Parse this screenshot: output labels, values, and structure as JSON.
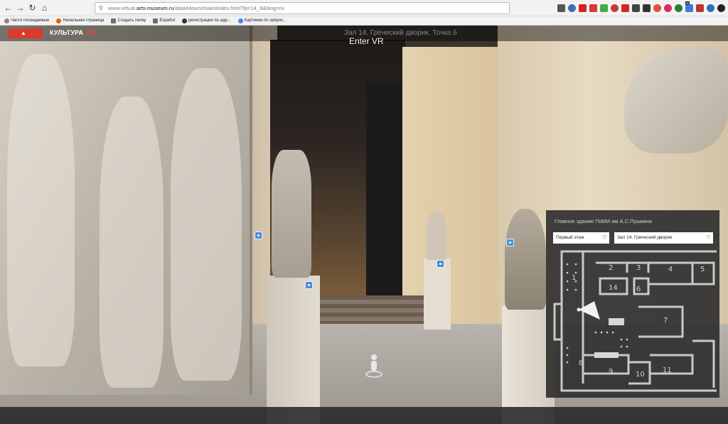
{
  "browser": {
    "url_prefix": "www.virtual.",
    "url_domain": "arts-museum.ru",
    "url_path": "/data/vtours/main/index.html?lp=14_6&lang=ru",
    "bookmarks": [
      {
        "label": "Часто посещаемые",
        "icon": "gear-icon"
      },
      {
        "label": "Начальная страница",
        "icon": "firefox-icon"
      },
      {
        "label": "Создать папку",
        "icon": "folder-icon"
      },
      {
        "label": "Español",
        "icon": "folder-icon"
      },
      {
        "label": "регистрация по адр...",
        "icon": "globe-icon"
      },
      {
        "label": "Картинки по запрос...",
        "icon": "google-icon"
      }
    ],
    "extension_badges": {
      "ext_10": "86"
    }
  },
  "header": {
    "logo_main": "КУЛЬТУРА",
    "logo_suffix": ".РФ",
    "scene_title": "Зал 14. Греческий дворик. Точка 6",
    "enter_vr": "Enter VR"
  },
  "map": {
    "title": "Главное здание ГМИИ им А.С.Пушкина",
    "floor_select": "Первый этаж",
    "hall_select": "Зал 14. Греческий дворик",
    "rooms": [
      "1",
      "2",
      "3",
      "4",
      "5",
      "6",
      "7",
      "8",
      "9",
      "10",
      "11",
      "14"
    ]
  },
  "colors": {
    "brand_red": "#d93a2b",
    "hotspot_blue": "#4b8fd1",
    "panel_bg": "#303030"
  }
}
